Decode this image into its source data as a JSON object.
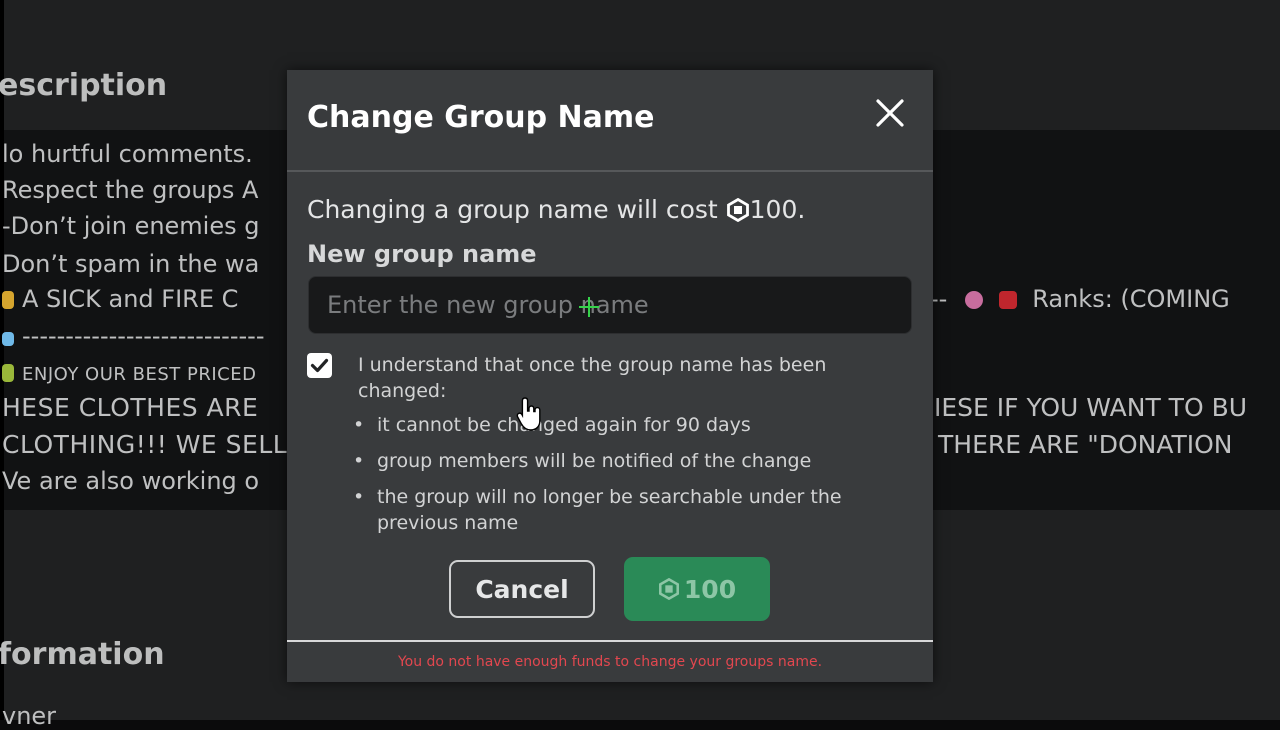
{
  "background": {
    "description_heading": "escription",
    "description_lines": [
      "lo hurtful comments.",
      "Respect the groups A",
      "-Don’t join enemies g",
      "Don’t spam in the wa",
      "A SICK and FIRE C",
      "----------------------------",
      "ENJOY OUR BEST PRICED",
      "HESE CLOTHES ARE",
      "CLOTHING!!! WE SELL",
      "Ve are also working o"
    ],
    "right_fragments": [
      "-- ",
      "Ranks: (COMING",
      "IESE IF YOU WANT TO BU",
      "THERE ARE \"DONATION"
    ],
    "information_heading": "formation",
    "owner_label": "vner"
  },
  "modal": {
    "title": "Change Group Name",
    "close_icon": "close-icon",
    "cost_text_prefix": "Changing a group name will cost ",
    "cost_amount": "100.",
    "field_label": "New group name",
    "input_placeholder": "Enter the new group name",
    "input_value": "",
    "checkbox_checked": true,
    "checkbox_label": "I understand that once the group name has been changed:",
    "bullets": [
      "it cannot be changed again for 90 days",
      "group members will be notified of the change",
      "the group will no longer be searchable under the previous name"
    ],
    "cancel_label": "Cancel",
    "buy_amount": "100",
    "error_message": "You do not have enough funds to change your groups name.",
    "accent_green": "#2a8a57",
    "error_color": "#e2474f"
  }
}
